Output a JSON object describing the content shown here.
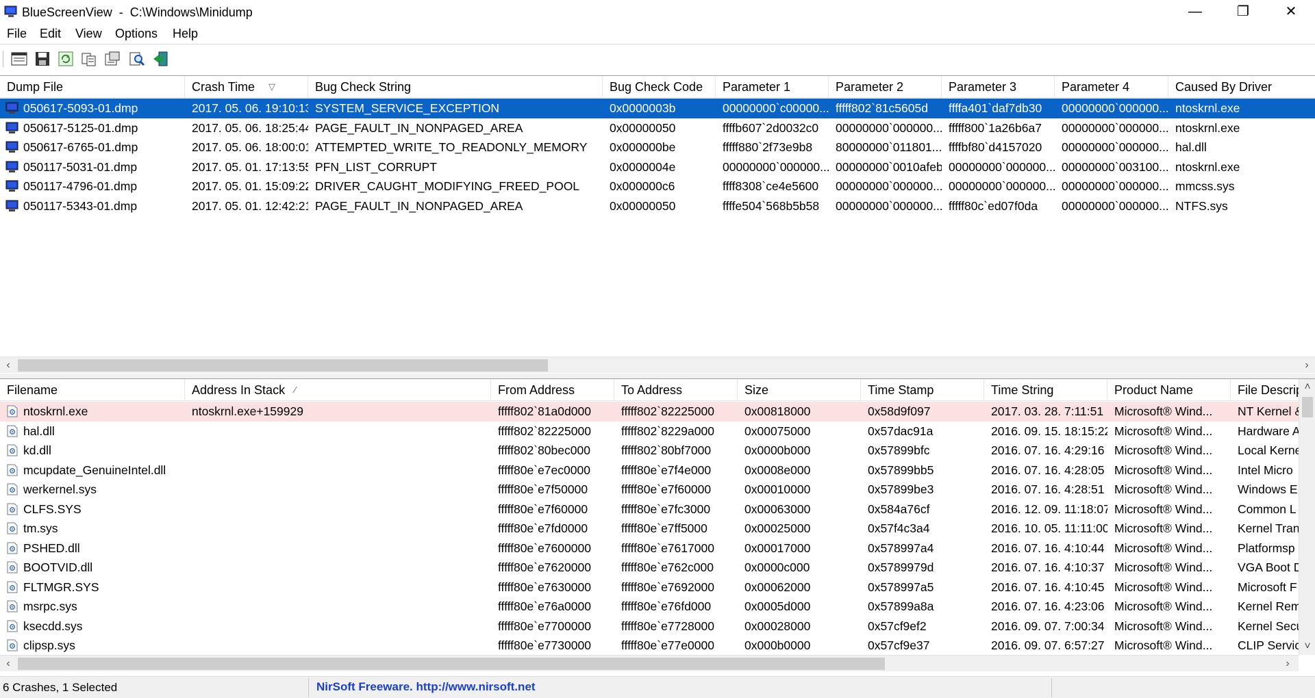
{
  "window": {
    "title": "BlueScreenView  -  C:\\Windows\\Minidump",
    "minimize": "—",
    "restore": "❐",
    "close": "✕"
  },
  "menu": [
    "File",
    "Edit",
    "View",
    "Options",
    "Help"
  ],
  "toolbar_icons": [
    "properties-window-icon",
    "save-icon",
    "refresh-icon",
    "copy-icon",
    "html-report-icon",
    "find-icon",
    "exit-icon"
  ],
  "crashes": {
    "columns": [
      "Dump File",
      "Crash Time",
      "Bug Check String",
      "Bug Check Code",
      "Parameter 1",
      "Parameter 2",
      "Parameter 3",
      "Parameter 4",
      "Caused By Driver"
    ],
    "sort_indicator": "▽",
    "rows": [
      [
        "050617-5093-01.dmp",
        "2017. 05. 06. 19:10:13",
        "SYSTEM_SERVICE_EXCEPTION",
        "0x0000003b",
        "00000000`c00000...",
        "fffff802`81c5605d",
        "ffffa401`daf7db30",
        "00000000`000000...",
        "ntoskrnl.exe"
      ],
      [
        "050617-5125-01.dmp",
        "2017. 05. 06. 18:25:44",
        "PAGE_FAULT_IN_NONPAGED_AREA",
        "0x00000050",
        "ffffb607`2d0032c0",
        "00000000`000000...",
        "fffff800`1a26b6a7",
        "00000000`000000...",
        "ntoskrnl.exe"
      ],
      [
        "050617-6765-01.dmp",
        "2017. 05. 06. 18:00:01",
        "ATTEMPTED_WRITE_TO_READONLY_MEMORY",
        "0x000000be",
        "fffff880`2f73e9b8",
        "80000000`011801...",
        "ffffbf80`d4157020",
        "00000000`000000...",
        "hal.dll"
      ],
      [
        "050117-5031-01.dmp",
        "2017. 05. 01. 17:13:55",
        "PFN_LIST_CORRUPT",
        "0x0000004e",
        "00000000`000000...",
        "00000000`0010afeb",
        "00000000`000000...",
        "00000000`003100...",
        "ntoskrnl.exe"
      ],
      [
        "050117-4796-01.dmp",
        "2017. 05. 01. 15:09:22",
        "DRIVER_CAUGHT_MODIFYING_FREED_POOL",
        "0x000000c6",
        "ffff8308`ce4e5600",
        "00000000`000000...",
        "00000000`000000...",
        "00000000`000000...",
        "mmcss.sys"
      ],
      [
        "050117-5343-01.dmp",
        "2017. 05. 01. 12:42:21",
        "PAGE_FAULT_IN_NONPAGED_AREA",
        "0x00000050",
        "ffffe504`568b5b58",
        "00000000`000000...",
        "fffff80c`ed07f0da",
        "00000000`000000...",
        "NTFS.sys"
      ]
    ]
  },
  "drivers": {
    "columns": [
      "Filename",
      "Address In Stack",
      "From Address",
      "To Address",
      "Size",
      "Time Stamp",
      "Time String",
      "Product Name",
      "File Descrip"
    ],
    "sort_indicator": "⁄",
    "rows": [
      [
        "ntoskrnl.exe",
        "ntoskrnl.exe+159929",
        "fffff802`81a0d000",
        "fffff802`82225000",
        "0x00818000",
        "0x58d9f097",
        "2017. 03. 28. 7:11:51",
        "Microsoft® Wind...",
        "NT Kernel &"
      ],
      [
        "hal.dll",
        "",
        "fffff802`82225000",
        "fffff802`8229a000",
        "0x00075000",
        "0x57dac91a",
        "2016. 09. 15. 18:15:22",
        "Microsoft® Wind...",
        "Hardware A"
      ],
      [
        "kd.dll",
        "",
        "fffff802`80bec000",
        "fffff802`80bf7000",
        "0x0000b000",
        "0x57899bfc",
        "2016. 07. 16. 4:29:16",
        "Microsoft® Wind...",
        "Local Kerne"
      ],
      [
        "mcupdate_GenuineIntel.dll",
        "",
        "fffff80e`e7ec0000",
        "fffff80e`e7f4e000",
        "0x0008e000",
        "0x57899bb5",
        "2016. 07. 16. 4:28:05",
        "Microsoft® Wind...",
        "Intel Micro"
      ],
      [
        "werkernel.sys",
        "",
        "fffff80e`e7f50000",
        "fffff80e`e7f60000",
        "0x00010000",
        "0x57899be3",
        "2016. 07. 16. 4:28:51",
        "Microsoft® Wind...",
        "Windows E"
      ],
      [
        "CLFS.SYS",
        "",
        "fffff80e`e7f60000",
        "fffff80e`e7fc3000",
        "0x00063000",
        "0x584a76cf",
        "2016. 12. 09. 11:18:07",
        "Microsoft® Wind...",
        "Common L"
      ],
      [
        "tm.sys",
        "",
        "fffff80e`e7fd0000",
        "fffff80e`e7ff5000",
        "0x00025000",
        "0x57f4c3a4",
        "2016. 10. 05. 11:11:00",
        "Microsoft® Wind...",
        "Kernel Tran"
      ],
      [
        "PSHED.dll",
        "",
        "fffff80e`e7600000",
        "fffff80e`e7617000",
        "0x00017000",
        "0x578997a4",
        "2016. 07. 16. 4:10:44",
        "Microsoft® Wind...",
        "Platformsp"
      ],
      [
        "BOOTVID.dll",
        "",
        "fffff80e`e7620000",
        "fffff80e`e762c000",
        "0x0000c000",
        "0x5789979d",
        "2016. 07. 16. 4:10:37",
        "Microsoft® Wind...",
        "VGA Boot D"
      ],
      [
        "FLTMGR.SYS",
        "",
        "fffff80e`e7630000",
        "fffff80e`e7692000",
        "0x00062000",
        "0x578997a5",
        "2016. 07. 16. 4:10:45",
        "Microsoft® Wind...",
        "Microsoft F"
      ],
      [
        "msrpc.sys",
        "",
        "fffff80e`e76a0000",
        "fffff80e`e76fd000",
        "0x0005d000",
        "0x57899a8a",
        "2016. 07. 16. 4:23:06",
        "Microsoft® Wind...",
        "Kernel Rem"
      ],
      [
        "ksecdd.sys",
        "",
        "fffff80e`e7700000",
        "fffff80e`e7728000",
        "0x00028000",
        "0x57cf9ef2",
        "2016. 09. 07. 7:00:34",
        "Microsoft® Wind...",
        "Kernel Secu"
      ],
      [
        "clipsp.sys",
        "",
        "fffff80e`e7730000",
        "fffff80e`e77e0000",
        "0x000b0000",
        "0x57cf9e37",
        "2016. 09. 07. 6:57:27",
        "Microsoft® Wind...",
        "CLIP Servic"
      ]
    ]
  },
  "status": {
    "count": "6 Crashes, 1 Selected",
    "link": "NirSoft Freeware.  http://www.nirsoft.net"
  },
  "colors": {
    "selection": "#0a64c8",
    "highlight_row": "#fbe1e2",
    "link": "#1a3fcf"
  }
}
